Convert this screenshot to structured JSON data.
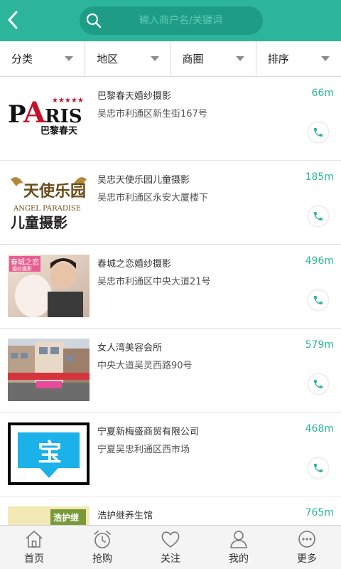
{
  "header": {
    "search_placeholder": "输入商户名/关键词",
    "accent": "#2cb59a"
  },
  "filters": [
    {
      "label": "分类"
    },
    {
      "label": "地区"
    },
    {
      "label": "商圈"
    },
    {
      "label": "排序"
    }
  ],
  "merchants": [
    {
      "name": "巴黎春天婚纱摄影",
      "address": "吴忠市利通区新生街167号",
      "distance": "66m",
      "logo_text": "PARIS",
      "logo_sub": "巴黎春天"
    },
    {
      "name": "吴忠天使乐园儿童摄影",
      "address": "吴忠市利通区永安大厦楼下",
      "distance": "185m",
      "logo_text": "天使乐园",
      "logo_en": "ANGEL PARADISE",
      "logo_sub": "儿童摄影"
    },
    {
      "name": "春城之恋婚纱摄影",
      "address": "吴忠市利通区中央大道21号",
      "distance": "496m",
      "logo_text": "春城之恋",
      "logo_sub": "婚纱摄影"
    },
    {
      "name": "女人湾美容会所",
      "address": "中央大道吴灵西路90号",
      "distance": "579m"
    },
    {
      "name": "宁夏新梅盛商贸有限公司",
      "address": "宁夏吴忠利通区西市场",
      "distance": "468m",
      "logo_text": "宝"
    },
    {
      "name": "浩护继养生馆",
      "address": "",
      "distance": "765m",
      "logo_text": "浩护继"
    }
  ],
  "tabbar": [
    {
      "label": "首页",
      "icon": "home-icon"
    },
    {
      "label": "抢购",
      "icon": "alarm-clock-icon"
    },
    {
      "label": "关注",
      "icon": "heart-icon"
    },
    {
      "label": "我的",
      "icon": "user-icon"
    },
    {
      "label": "更多",
      "icon": "more-icon"
    }
  ]
}
